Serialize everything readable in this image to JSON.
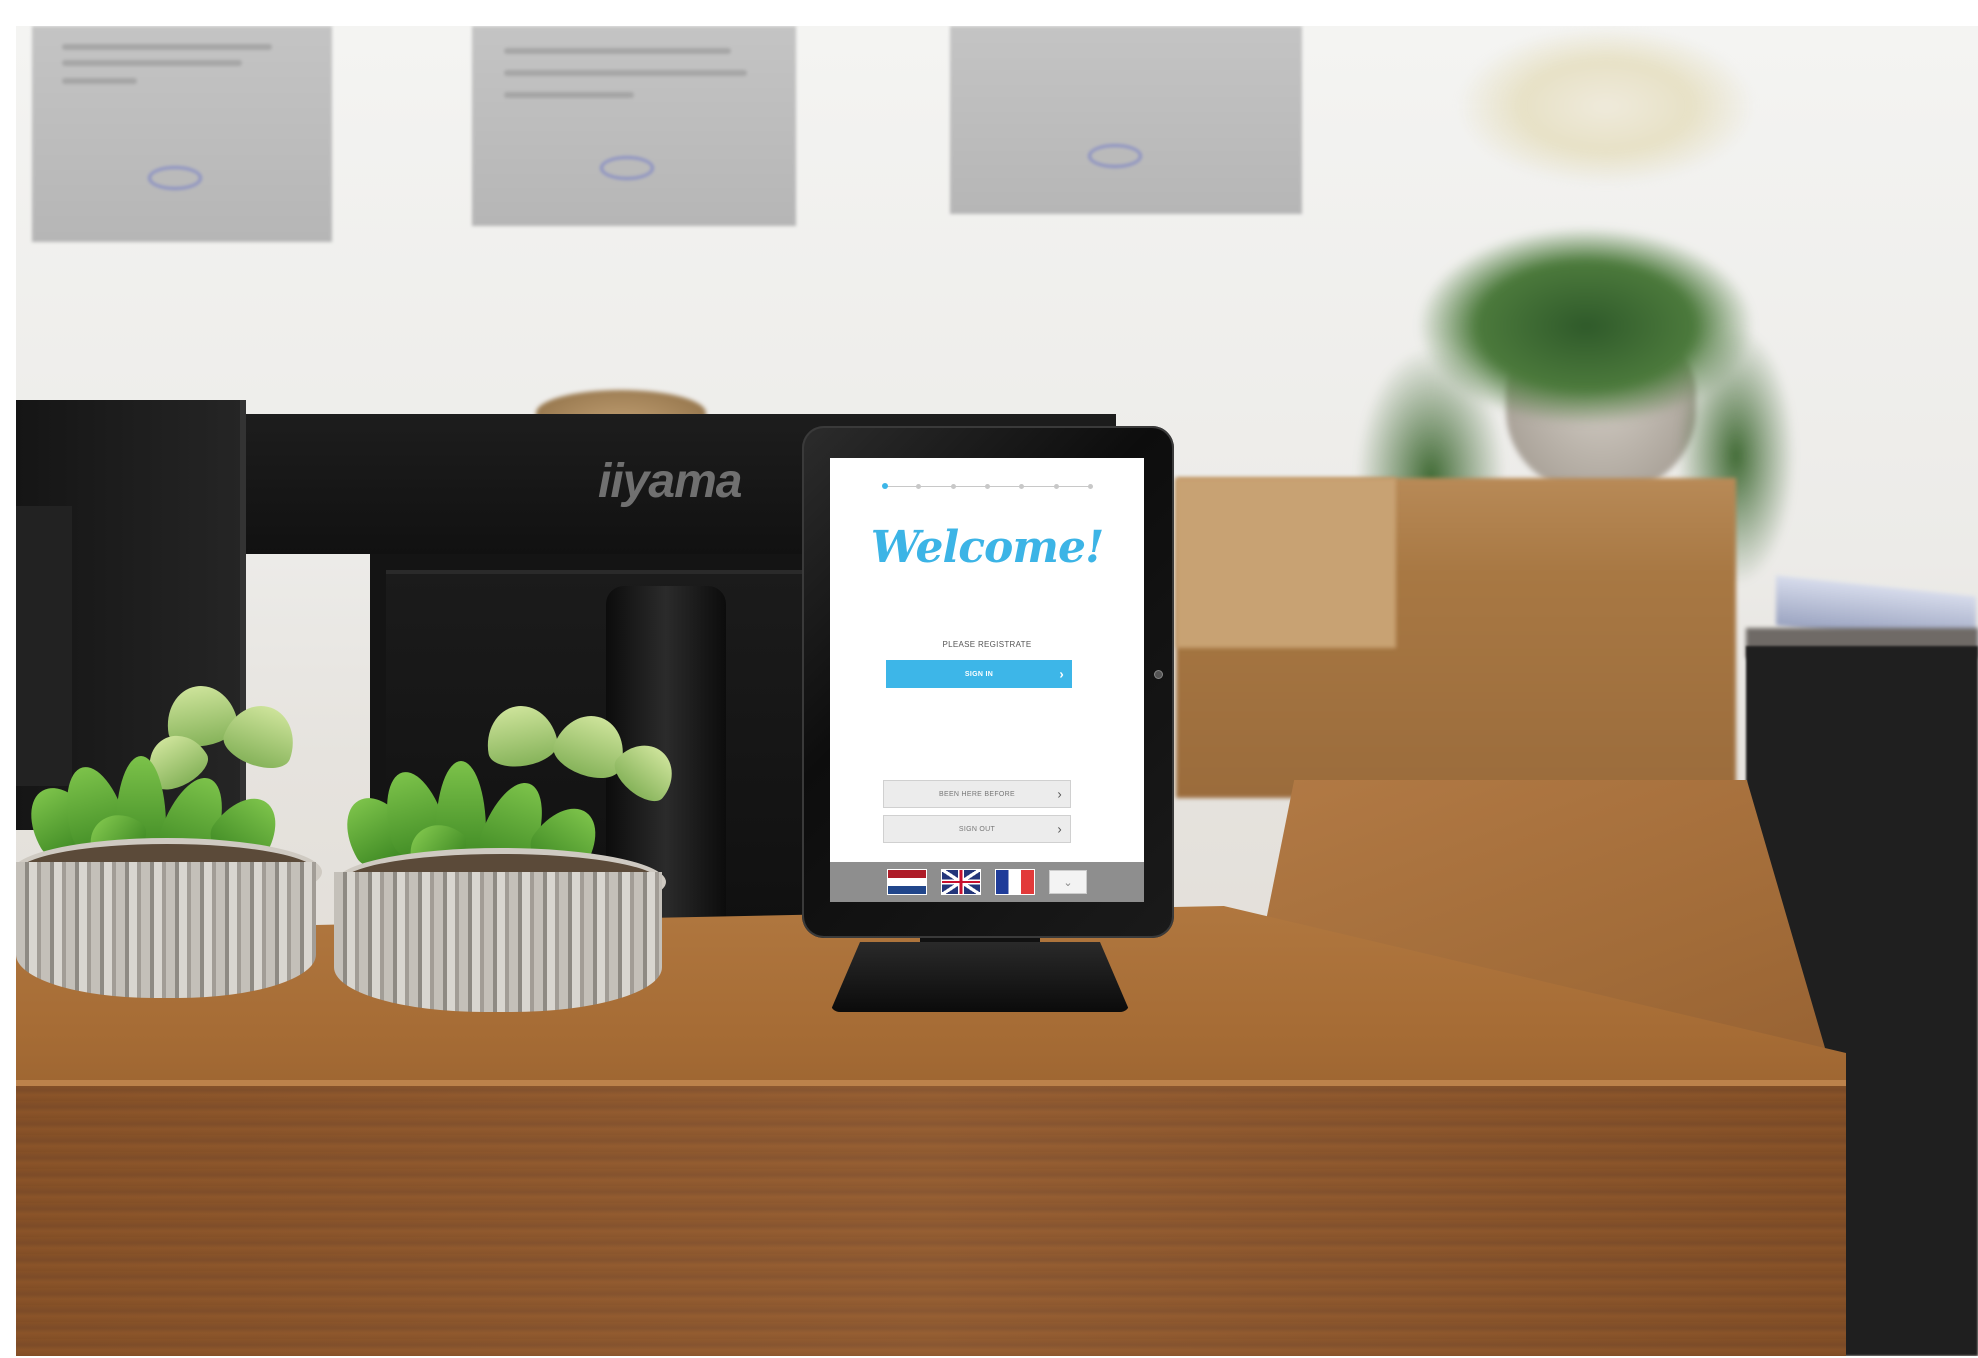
{
  "scene": {
    "monitor_brand": "iiyama"
  },
  "kiosk": {
    "progress": {
      "total_steps": 7,
      "current_step": 1
    },
    "welcome_title": "Welcome!",
    "prompt": "PLEASE REGISTRATE",
    "sign_in_label": "SIGN IN",
    "been_here_label": "BEEN HERE BEFORE",
    "sign_out_label": "SIGN OUT",
    "languages": [
      "nl-flag-icon",
      "uk-flag-icon",
      "fr-flag-icon"
    ],
    "more_languages_icon": "chevron-down-icon",
    "accent_color": "#3db6e8"
  }
}
